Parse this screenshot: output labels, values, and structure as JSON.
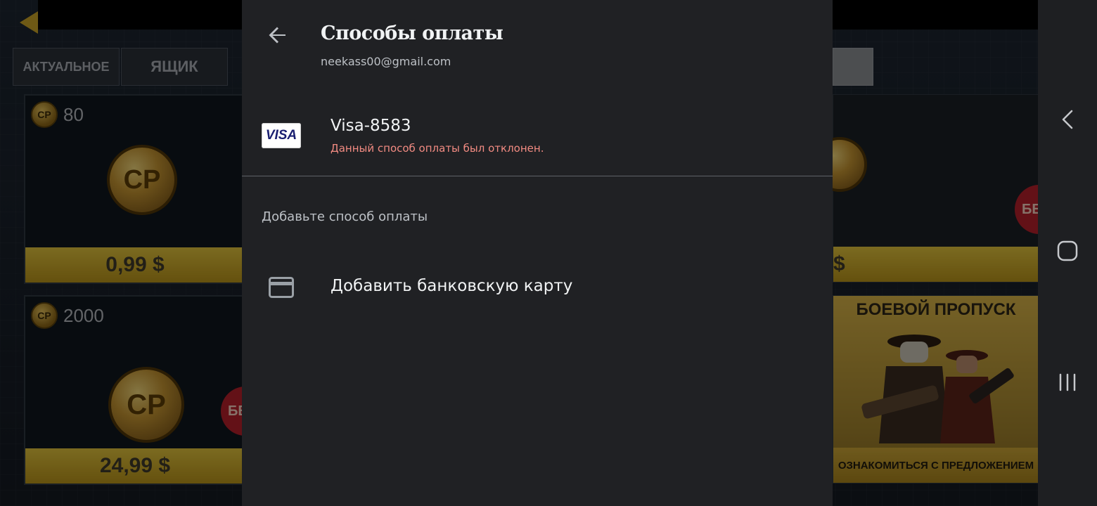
{
  "dialog": {
    "title": "Способы оплаты",
    "account": "neekass00@gmail.com",
    "payment_method": {
      "card_brand": "VISA",
      "name": "Visa-8583",
      "status": "Данный способ оплаты был отклонен."
    },
    "add_section": {
      "label": "Добавьте способ оплаты",
      "add_card_label": "Добавить банковскую карту"
    },
    "icons": {
      "back": "back-arrow-icon",
      "card": "credit-card-icon"
    }
  },
  "background_store": {
    "tabs": [
      "АКТУАЛЬНОЕ",
      "ЯЩИК"
    ],
    "items": [
      {
        "amount": "80",
        "price": "0,99 $"
      },
      {
        "amount": "2000",
        "price": "24,99 $"
      }
    ],
    "right_cards": {
      "top_price_fragment": "$",
      "battle_pass_title": "БОЕВОЙ ПРОПУСК",
      "battle_pass_footer": "ОЗНАКОМИТЬСЯ С ПРЕДЛОЖЕНИЕМ",
      "sale_badge_fragment": "БЕ"
    },
    "currency_badge": "CP"
  },
  "navbar": {
    "icons": [
      "back-nav-icon",
      "home-nav-icon",
      "recents-nav-icon"
    ]
  },
  "colors": {
    "dialog_bg": "#202124",
    "error": "#f28b82",
    "gold": "#c9a227",
    "visa_blue": "#1a1f71"
  }
}
